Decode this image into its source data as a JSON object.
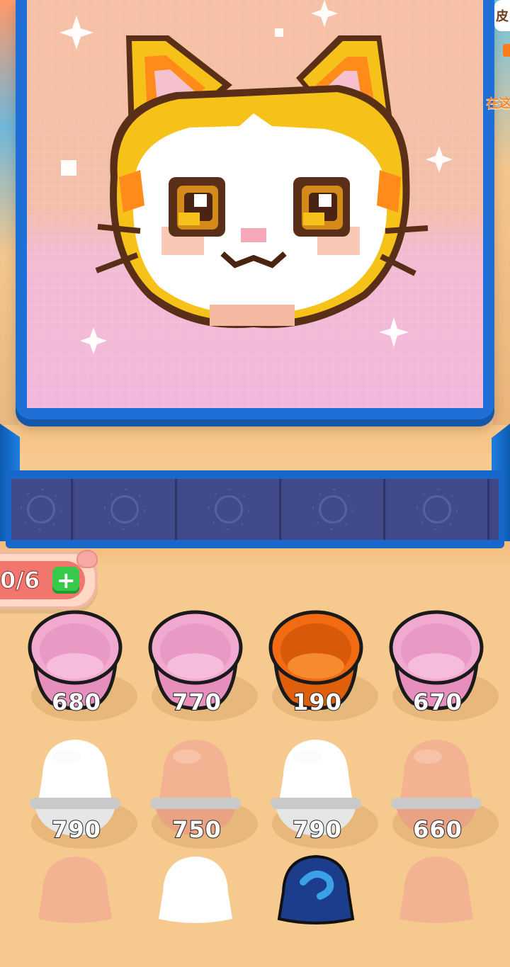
{
  "side_panel": {
    "badge_text": "皮",
    "hint_text": "在这"
  },
  "capacity": {
    "text": "0/6",
    "add_label": "+"
  },
  "buckets_open": [
    {
      "count": "680",
      "color": "pink"
    },
    {
      "count": "770",
      "color": "pink"
    },
    {
      "count": "190",
      "color": "orange"
    },
    {
      "count": "670",
      "color": "pink"
    }
  ],
  "buckets_capped": [
    {
      "count": "790",
      "color": "white"
    },
    {
      "count": "750",
      "color": "peach"
    },
    {
      "count": "790",
      "color": "white"
    },
    {
      "count": "660",
      "color": "peach"
    }
  ],
  "buckets_partial": [
    {
      "color": "peach"
    },
    {
      "color": "white"
    },
    {
      "color": "navy-blue"
    },
    {
      "color": "peach"
    }
  ],
  "colors": {
    "pink": "#f2a9cf",
    "orange": "#f26b12",
    "white": "#ffffff",
    "peach": "#f3b292",
    "navy-blue": "#1c3d8c",
    "board_blue": "#1f6fd6"
  }
}
